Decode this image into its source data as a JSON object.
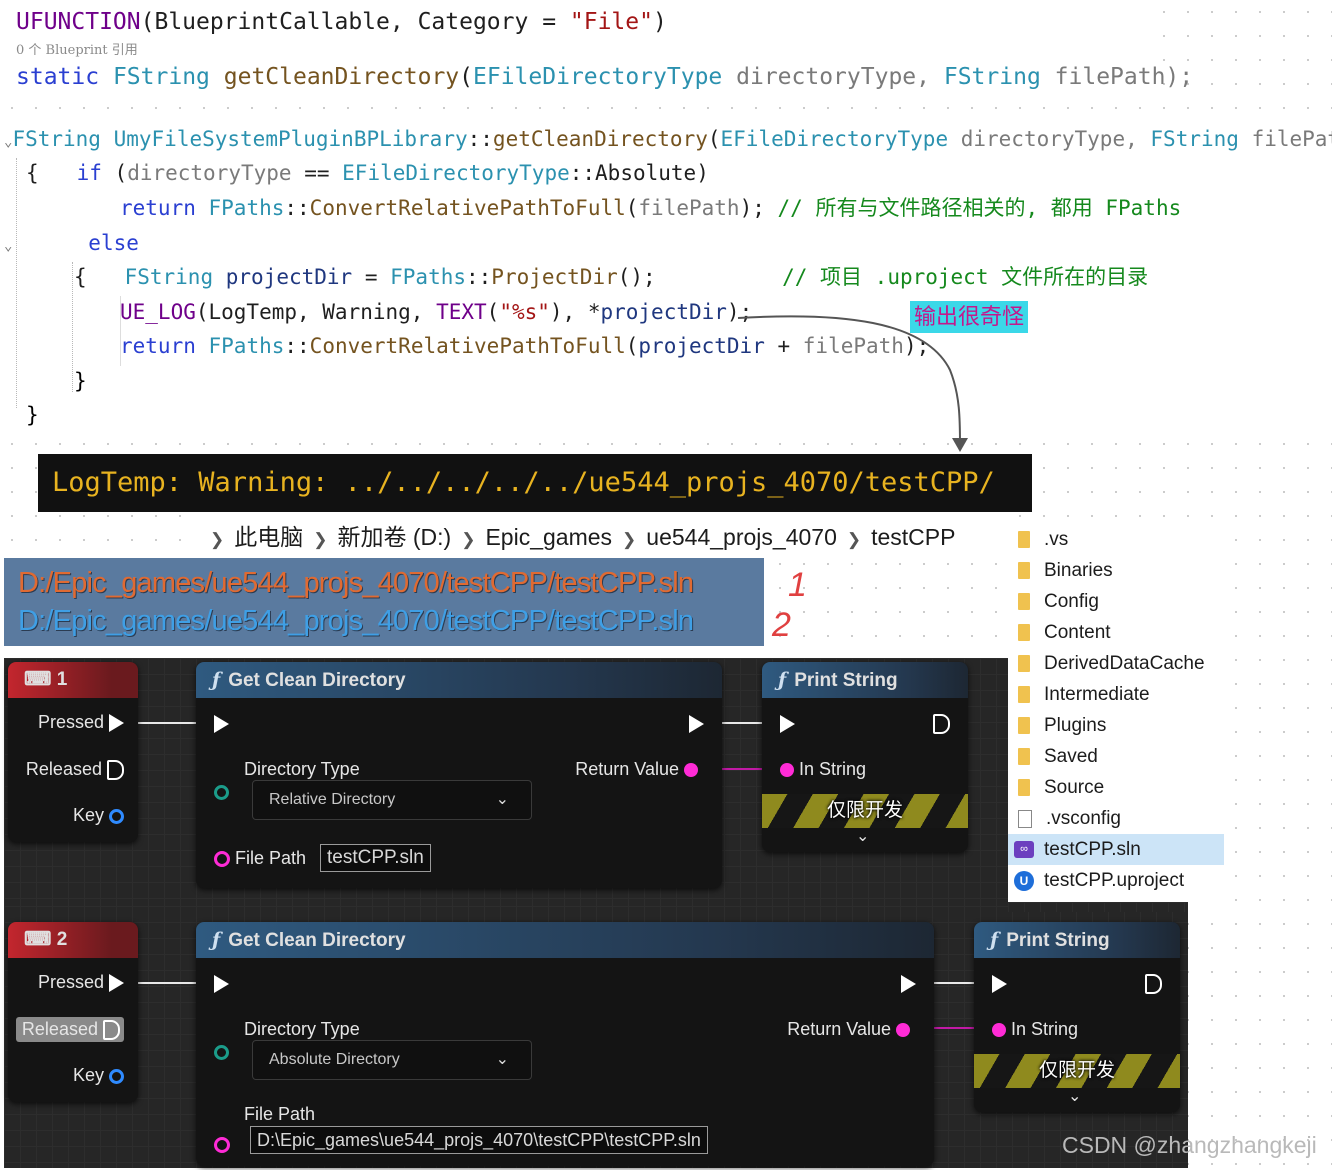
{
  "header_decl": {
    "macro": "UFUNCTION",
    "macro_args_open": "(BlueprintCallable, Category = ",
    "macro_str": "\"File\"",
    "macro_close": ")",
    "ref_hint": "0 个 Blueprint 引用",
    "kw_static": "static",
    "ret_type": "FString",
    "fn_name": "getCleanDirectory",
    "p1_type": "EFileDirectoryType",
    "p1_name": "directoryType,",
    "p2_type": "FString",
    "p2_name": "filePath);"
  },
  "impl": {
    "sig_type": "FString",
    "sig_class": "UmyFileSystemPluginBPLibrary",
    "sig_sep": "::",
    "sig_fn": "getCleanDirectory",
    "sig_paren": "(",
    "sig_p1t": "EFileDirectoryType",
    "sig_p1n": " directoryType,",
    "sig_p2t": "FString",
    "sig_p2n": " filePath)",
    "brace_open": "{",
    "if_kw": "if",
    "if_cond_open": "(",
    "if_var": "directoryType",
    "if_eq": " == ",
    "if_enum": "EFileDirectoryType",
    "if_enum_sep": "::",
    "if_enum_val": "Absolute",
    "if_close": ")",
    "ret1_kw": "return",
    "ret1_cls": "FPaths",
    "ret1_sep": "::",
    "ret1_fn": "ConvertRelativePathToFull",
    "ret1_arg_open": "(",
    "ret1_arg": "filePath",
    "ret1_arg_close": ");",
    "ret1_comment": "// 所有与文件路径相关的, 都用 FPaths",
    "else_kw": "else",
    "brace2": "{",
    "pd_type": "FString",
    "pd_var": "projectDir",
    "pd_eq": " = ",
    "pd_cls": "FPaths",
    "pd_sep": "::",
    "pd_fn": "ProjectDir",
    "pd_end": "();",
    "pd_comment": "// 项目 .uproject 文件所在的目录",
    "log_macro": "UE_LOG",
    "log_open": "(LogTemp, Warning, ",
    "log_text": "TEXT",
    "log_fmt_open": "(",
    "log_fmt": "\"%s\"",
    "log_fmt_close": "), ",
    "log_star": "*",
    "log_var": "projectDir",
    "log_end": ");",
    "ret2_kw": "return",
    "ret2_cls": "FPaths",
    "ret2_sep": "::",
    "ret2_fn": "ConvertRelativePathToFull",
    "ret2_open": "(",
    "ret2_a": "projectDir",
    "ret2_plus": " + ",
    "ret2_b": "filePath",
    "ret2_end": ");",
    "brace2_close": "}",
    "brace_close": "}"
  },
  "annotation_note": "输出很奇怪",
  "log_line": "LogTemp: Warning: ../../../../../ue544_projs_4070/testCPP/",
  "explorer": {
    "breadcrumbs": [
      "此电脑",
      "新加卷 (D:)",
      "Epic_games",
      "ue544_projs_4070",
      "testCPP"
    ],
    "items": [
      {
        "name": ".vs",
        "kind": "folder"
      },
      {
        "name": "Binaries",
        "kind": "folder"
      },
      {
        "name": "Config",
        "kind": "folder"
      },
      {
        "name": "Content",
        "kind": "folder"
      },
      {
        "name": "DerivedDataCache",
        "kind": "folder"
      },
      {
        "name": "Intermediate",
        "kind": "folder"
      },
      {
        "name": "Plugins",
        "kind": "folder"
      },
      {
        "name": "Saved",
        "kind": "folder"
      },
      {
        "name": "Source",
        "kind": "folder"
      },
      {
        "name": ".vsconfig",
        "kind": "file"
      },
      {
        "name": "testCPP.sln",
        "kind": "sln",
        "selected": true
      },
      {
        "name": "testCPP.uproject",
        "kind": "uproject"
      }
    ]
  },
  "output_paths": {
    "line1": "D:/Epic_games/ue544_projs_4070/testCPP/testCPP.sln",
    "line2": "D:/Epic_games/ue544_projs_4070/testCPP/testCPP.sln",
    "mark1": "1",
    "mark2": "2"
  },
  "graph": {
    "row1": {
      "key_title": "1",
      "pressed": "Pressed",
      "released": "Released",
      "key": "Key",
      "fn_title": "Get Clean Directory",
      "dir_label": "Directory Type",
      "dir_value": "Relative Directory",
      "return_label": "Return Value",
      "file_label": "File Path",
      "file_value": "testCPP.sln",
      "print_title": "Print String",
      "in_string": "In String",
      "dev_only": "仅限开发"
    },
    "row2": {
      "key_title": "2",
      "pressed": "Pressed",
      "released": "Released",
      "key": "Key",
      "fn_title": "Get Clean Directory",
      "dir_label": "Directory Type",
      "dir_value": "Absolute Directory",
      "return_label": "Return Value",
      "file_label": "File Path",
      "file_value": "D:\\Epic_games\\ue544_projs_4070\\testCPP\\testCPP.sln",
      "print_title": "Print String",
      "in_string": "In String",
      "dev_only": "仅限开发"
    }
  },
  "watermark": "CSDN @zhangzhangkeji"
}
